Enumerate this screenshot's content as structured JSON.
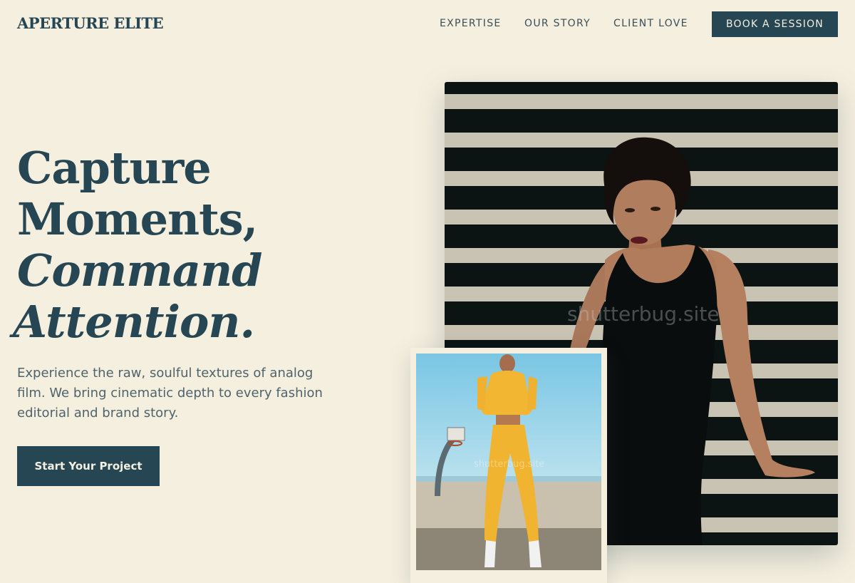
{
  "header": {
    "brand": "APERTURE ELITE",
    "nav": {
      "expertise": "EXPERTISE",
      "story": "OUR STORY",
      "client_love": "CLIENT LOVE"
    },
    "book_button": "BOOK A SESSION"
  },
  "hero": {
    "title_line1": "Capture",
    "title_line2": "Moments,",
    "title_line3": "Command",
    "title_line4": "Attention.",
    "subtitle": "Experience the raw, soulful textures of analog film. We bring cinematic depth to every fashion editorial and brand story.",
    "cta_button": "Start Your Project"
  },
  "photos": {
    "watermark": "shutterbug.site",
    "watermark_small": "shutterbug.site"
  },
  "colors": {
    "background": "#f5efdf",
    "primary": "#264653",
    "body_text": "#4f636c"
  }
}
